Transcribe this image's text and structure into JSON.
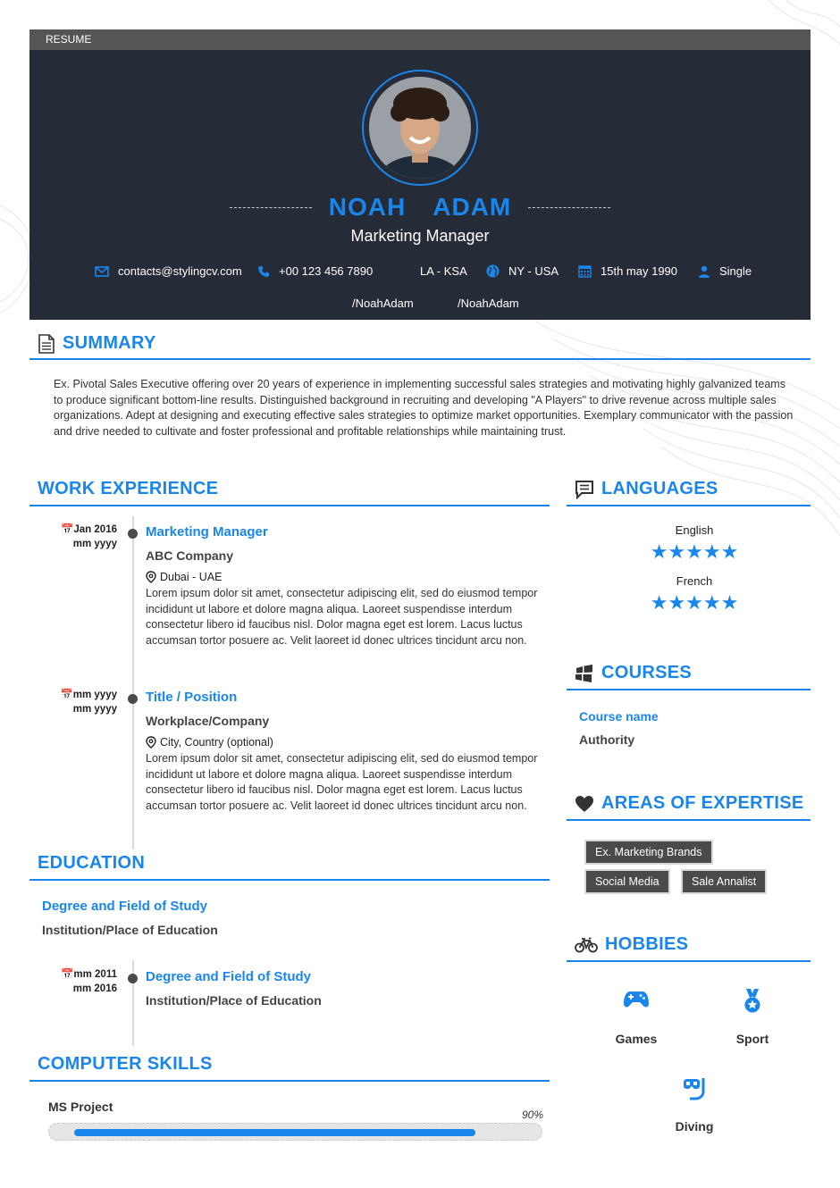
{
  "topbar": {
    "label": "RESUME"
  },
  "profile": {
    "first_name": "NOAH",
    "last_name": "ADAM",
    "role": "Marketing Manager",
    "email": "contacts@stylingcv.com",
    "phone": "+00 123 456 7890",
    "location1": "LA - KSA",
    "location2": "NY - USA",
    "birthdate": "15th may 1990",
    "status": "Single",
    "social1": "/NoahAdam",
    "social2": "/NoahAdam"
  },
  "summary": {
    "title": "SUMMARY",
    "text": "Ex. Pivotal Sales Executive offering over 20 years of experience in implementing successful sales strategies and motivating highly galvanized teams to produce significant bottom-line results. Distinguished background in recruiting and developing \"A Players\" to drive revenue across multiple sales organizations. Adept at designing and executing effective sales strategies to optimize market opportunities. Exemplary communicator with the passion and drive needed to cultivate and foster professional and profitable relationships while maintaining trust."
  },
  "work": {
    "title": "WORK EXPERIENCE",
    "items": [
      {
        "date1": "Jan 2016",
        "date2": "mm yyyy",
        "title": "Marketing Manager",
        "company": "ABC Company",
        "location": "Dubai - UAE",
        "desc": "Lorem ipsum dolor sit amet, consectetur adipiscing elit, sed do eiusmod tempor incididunt ut labore et dolore magna aliqua. Laoreet suspendisse interdum consectetur libero id faucibus nisl. Dolor magna eget est lorem. Lacus luctus accumsan tortor posuere ac. Velit laoreet id donec ultrices tincidunt arcu non."
      },
      {
        "date1": "mm yyyy",
        "date2": "mm yyyy",
        "title": "Title / Position",
        "company": "Workplace/Company",
        "location": "City, Country (optional)",
        "desc": "Lorem ipsum dolor sit amet, consectetur adipiscing elit, sed do eiusmod tempor incididunt ut labore et dolore magna aliqua. Laoreet suspendisse interdum consectetur libero id faucibus nisl. Dolor magna eget est lorem. Lacus luctus accumsan tortor posuere ac. Velit laoreet id donec ultrices tincidunt arcu non."
      }
    ]
  },
  "education": {
    "title": "EDUCATION",
    "items": [
      {
        "degree": "Degree and Field of Study",
        "school": "Institution/Place of Education"
      },
      {
        "date1": "mm 2011",
        "date2": "mm 2016",
        "degree": "Degree and Field of Study",
        "school": "Institution/Place of Education"
      }
    ]
  },
  "skills": {
    "title": "COMPUTER SKILLS",
    "items": [
      {
        "name": "MS Project",
        "level": "90%",
        "value": 0.9
      }
    ]
  },
  "languages": {
    "title": "LANGUAGES",
    "items": [
      {
        "name": "English",
        "stars": "★★★★★",
        "rating": 5
      },
      {
        "name": "French",
        "stars": "★★★★★",
        "rating": 5
      }
    ]
  },
  "courses": {
    "title": "COURSES",
    "items": [
      {
        "name": "Course name",
        "authority": "Authority"
      }
    ]
  },
  "expertise": {
    "title": "AREAS OF EXPERTISE",
    "tags": [
      "Ex. Marketing Brands",
      "Social Media",
      "Sale Annalist"
    ]
  },
  "hobbies": {
    "title": "HOBBIES",
    "items": [
      {
        "name": "Games",
        "icon": "gamepad-icon"
      },
      {
        "name": "Sport",
        "icon": "medal-icon"
      },
      {
        "name": "Diving",
        "icon": "diving-mask-icon"
      }
    ]
  },
  "colors": {
    "accent": "#1a86ec",
    "header_bg": "#262b38",
    "topbar_bg": "#555555",
    "tag_bg": "#4a4a4a"
  }
}
